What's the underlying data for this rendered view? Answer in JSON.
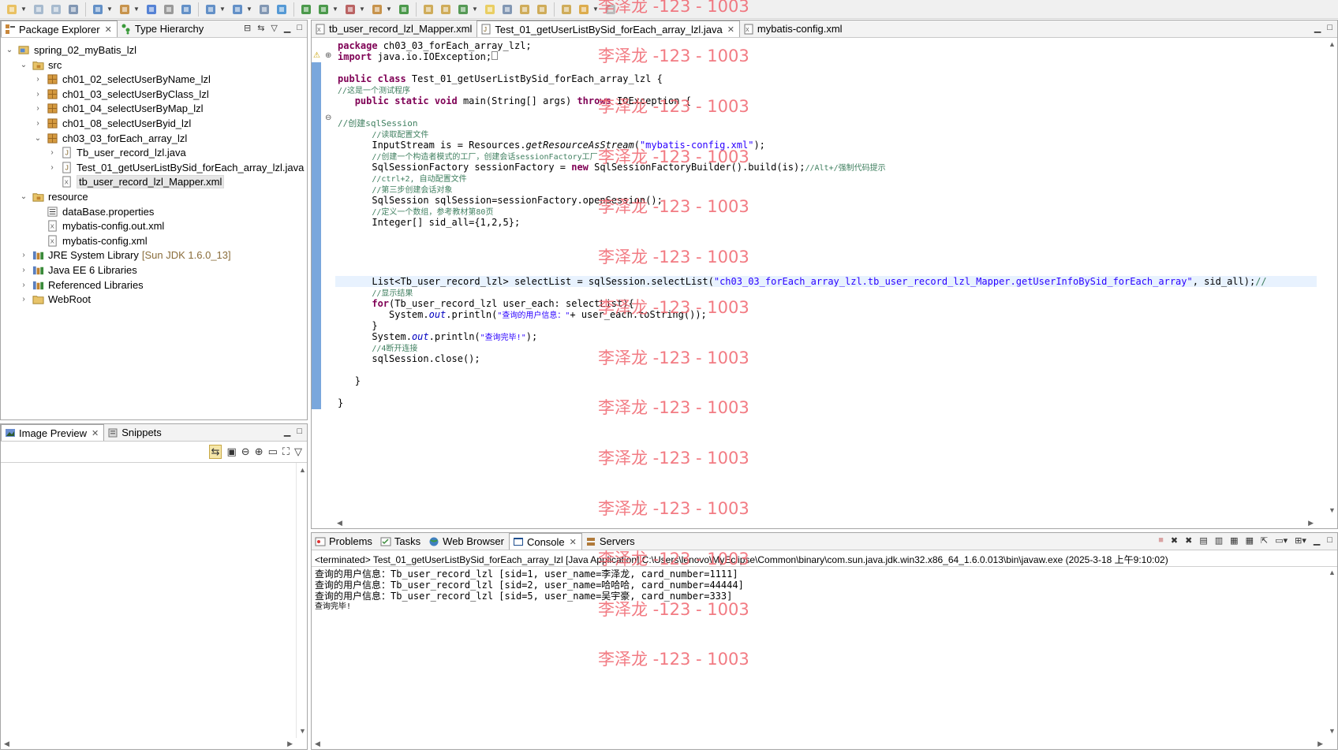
{
  "toolbar": {
    "icons": [
      "new-icon",
      "save-icon",
      "save-all-icon",
      "print-icon",
      "wizard-icon",
      "package-icon",
      "server-icon",
      "deploy-icon",
      "web-icon",
      "search-icon",
      "open-type-icon",
      "build-icon",
      "globe-icon",
      "debug-icon",
      "run-icon",
      "external-tools-icon",
      "new-package-icon",
      "refresh-icon",
      "open-icon",
      "pin-icon",
      "annotate-icon",
      "highlight-icon",
      "whitespace-icon",
      "next-annotation-icon",
      "prev-annotation-icon",
      "last-edit-icon",
      "back-icon",
      "forward-icon"
    ]
  },
  "package_explorer": {
    "tabs": [
      {
        "label": "Package Explorer",
        "active": true
      },
      {
        "label": "Type Hierarchy",
        "active": false
      }
    ],
    "tree": [
      {
        "label": "spring_02_myBatis_lzl",
        "icon": "project-icon",
        "toggle": "▼"
      },
      {
        "label": "src",
        "icon": "source-folder-icon",
        "toggle": "▼"
      },
      {
        "label": "ch01_02_selectUserByName_lzl",
        "icon": "package-icon",
        "toggle": "▷"
      },
      {
        "label": "ch01_03_selectUserByClass_lzl",
        "icon": "package-icon",
        "toggle": "▷"
      },
      {
        "label": "ch01_04_selectUserByMap_lzl",
        "icon": "package-icon",
        "toggle": "▷"
      },
      {
        "label": "ch01_08_selectUserByid_lzl",
        "icon": "package-icon",
        "toggle": "▷"
      },
      {
        "label": "ch03_03_forEach_array_lzl",
        "icon": "package-icon",
        "toggle": "▼"
      },
      {
        "label": "Tb_user_record_lzl.java",
        "icon": "java-file-icon",
        "toggle": "▷"
      },
      {
        "label": "Test_01_getUserListBySid_forEach_array_lzl.java",
        "icon": "java-file-icon",
        "toggle": "▷"
      },
      {
        "label": "tb_user_record_lzl_Mapper.xml",
        "icon": "xml-file-icon",
        "toggle": "",
        "selected": true
      },
      {
        "label": "resource",
        "icon": "source-folder-icon",
        "toggle": "▼"
      },
      {
        "label": "dataBase.properties",
        "icon": "properties-file-icon",
        "toggle": ""
      },
      {
        "label": "mybatis-config.out.xml",
        "icon": "xml-file-icon",
        "toggle": ""
      },
      {
        "label": "mybatis-config.xml",
        "icon": "xml-file-icon",
        "toggle": ""
      },
      {
        "label": "JRE System Library",
        "suffix": "[Sun JDK 1.6.0_13]",
        "icon": "library-icon",
        "toggle": "▷"
      },
      {
        "label": "Java EE 6 Libraries",
        "icon": "library-icon",
        "toggle": "▷"
      },
      {
        "label": "Referenced Libraries",
        "icon": "library-icon",
        "toggle": "▷"
      },
      {
        "label": "WebRoot",
        "icon": "folder-icon",
        "toggle": "▷"
      }
    ]
  },
  "image_preview": {
    "tabs": [
      {
        "label": "Image Preview",
        "active": true
      },
      {
        "label": "Snippets",
        "active": false
      }
    ]
  },
  "editor": {
    "tabs": [
      {
        "label": "tb_user_record_lzl_Mapper.xml",
        "active": false
      },
      {
        "label": "Test_01_getUserListBySid_forEach_array_lzl.java",
        "active": true
      },
      {
        "label": "mybatis-config.xml",
        "active": false
      }
    ],
    "code": {
      "package_kw": "package",
      "package_name": " ch03_03_forEach_array_lzl;",
      "import_kw": "import",
      "import_name": " java.io.IOException;",
      "class_kw": "public class",
      "class_name": " Test_01_getUserListBySid_forEach_array_lzl {",
      "comment1": "//这是一个测试程序",
      "main_kw": "public static void",
      "main_sig": " main(String[] args) ",
      "throws_kw": "throws",
      "throws_rest": " IOException {",
      "comment2": "//创建sqlSession",
      "comment3": "//读取配置文件",
      "stream_a": "InputStream is = Resources.",
      "stream_b": "getResourceAsStream",
      "stream_c": "(",
      "stream_str": "\"mybatis-config.xml\"",
      "stream_d": ");",
      "comment4": "//创建一个构造者模式的工厂，创建会话sessionFactory工厂",
      "factory_a": "SqlSessionFactory sessionFactory = ",
      "factory_new": "new",
      "factory_b": " SqlSessionFactoryBuilder().build(is);",
      "factory_cm": "//Alt+/强制代码提示",
      "comment5": "//ctrl+2, 自动配置文件",
      "comment6": "//第三步创建会话对象",
      "session_line": "SqlSession sqlSession=sessionFactory.openSession();",
      "comment7": "//定义一个数组，参考教材第80页",
      "array_line": "Integer[] sid_all={1,2,5};",
      "list_a": "List<Tb_user_record_lzl> selectList = sqlSession.selectList(",
      "list_str": "\"ch03_03_forEach_array_lzl.tb_user_record_lzl_Mapper.getUserInfoBySid_forEach_array\"",
      "list_b": ", sid_all);",
      "list_cm": "//",
      "comment8": "//显示结果",
      "for_kw": "for",
      "for_rest": "(Tb_user_record_lzl user_each: selectList){",
      "print_a": "System.",
      "print_out": "out",
      "print_b": ".println(",
      "print_str": "\"查询的用户信息：\"",
      "print_c": "+ user_each.toString());",
      "close_brace1": "}",
      "done_a": "System.",
      "done_out": "out",
      "done_b": ".println(",
      "done_str": "\"查询完毕!\"",
      "done_c": ");",
      "comment9": "//4断开连接",
      "close_line": "sqlSession.close();",
      "close_brace2": "}",
      "close_brace3": "}"
    }
  },
  "console": {
    "tabs": [
      {
        "label": "Problems",
        "active": false
      },
      {
        "label": "Tasks",
        "active": false
      },
      {
        "label": "Web Browser",
        "active": false
      },
      {
        "label": "Console",
        "active": true
      },
      {
        "label": "Servers",
        "active": false
      }
    ],
    "status": "<terminated> Test_01_getUserListBySid_forEach_array_lzl [Java Application] C:\\Users\\lenovo\\MyEclipse\\Common\\binary\\com.sun.java.jdk.win32.x86_64_1.6.0.013\\bin\\javaw.exe (2025-3-18 上午9:10:02)",
    "output": [
      "查询的用户信息：Tb_user_record_lzl [sid=1, user_name=李泽龙, card_number=1111]",
      "查询的用户信息：Tb_user_record_lzl [sid=2, user_name=哈哈哈, card_number=44444]",
      "查询的用户信息：Tb_user_record_lzl [sid=5, user_name=吴宇豪, card_number=333]",
      "查询完毕!"
    ]
  },
  "watermark": {
    "text": "李泽龙 -123 - 1003",
    "color": "#f0646e"
  }
}
